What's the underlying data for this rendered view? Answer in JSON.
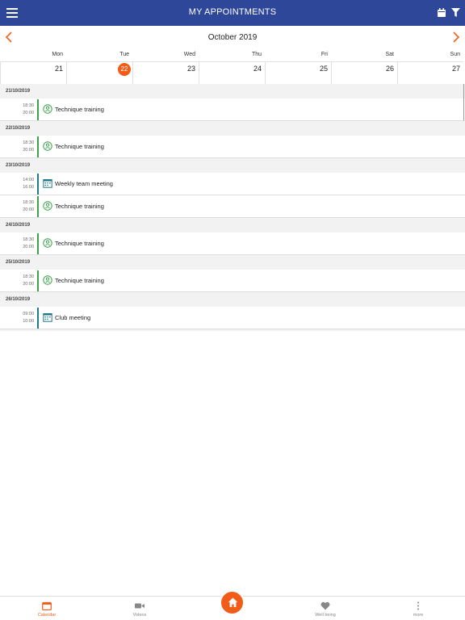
{
  "header": {
    "title": "MY APPOINTMENTS",
    "menu_icon": "hamburger-menu-icon",
    "calendar_icon": "calendar-icon",
    "filter_icon": "filter-icon"
  },
  "month_nav": {
    "label": "October 2019"
  },
  "week": {
    "day_names": [
      "Mon",
      "Tue",
      "Wed",
      "Thu",
      "Fri",
      "Sat",
      "Sun"
    ],
    "dates": [
      "21",
      "22",
      "23",
      "24",
      "25",
      "26",
      "27"
    ],
    "selected": "22"
  },
  "groups": [
    {
      "date": "21/10/2019",
      "items": [
        {
          "start": "18:30",
          "end": "20:00",
          "title": "Technique training",
          "icon": "training-icon"
        }
      ]
    },
    {
      "date": "22/10/2019",
      "items": [
        {
          "start": "18:30",
          "end": "20:00",
          "title": "Technique training",
          "icon": "training-icon"
        }
      ]
    },
    {
      "date": "23/10/2019",
      "items": [
        {
          "start": "14:00",
          "end": "16:00",
          "title": "Weekly team meeting",
          "icon": "meeting-icon"
        },
        {
          "start": "18:30",
          "end": "20:00",
          "title": "Technique training",
          "icon": "training-icon"
        }
      ]
    },
    {
      "date": "24/10/2019",
      "items": [
        {
          "start": "18:30",
          "end": "20:00",
          "title": "Technique training",
          "icon": "training-icon"
        }
      ]
    },
    {
      "date": "25/10/2019",
      "items": [
        {
          "start": "18:30",
          "end": "20:00",
          "title": "Technique training",
          "icon": "training-icon"
        }
      ]
    },
    {
      "date": "26/10/2019",
      "items": [
        {
          "start": "09:00",
          "end": "10:00",
          "title": "Club meeting",
          "icon": "meeting-icon"
        }
      ]
    }
  ],
  "colors": {
    "header": "#2f4799",
    "accent": "#f25c19",
    "training": "#3aa34a",
    "meeting": "#1f7a8c"
  },
  "tabs": [
    {
      "label": "Calendar",
      "icon": "calendar-icon",
      "active": true
    },
    {
      "label": "Videos",
      "icon": "video-camera-icon",
      "active": false
    },
    {
      "label": "",
      "icon": "home-icon",
      "active": false
    },
    {
      "label": "Well being",
      "icon": "heart-icon",
      "active": false
    },
    {
      "label": "more",
      "icon": "more-vertical-icon",
      "active": false
    }
  ]
}
